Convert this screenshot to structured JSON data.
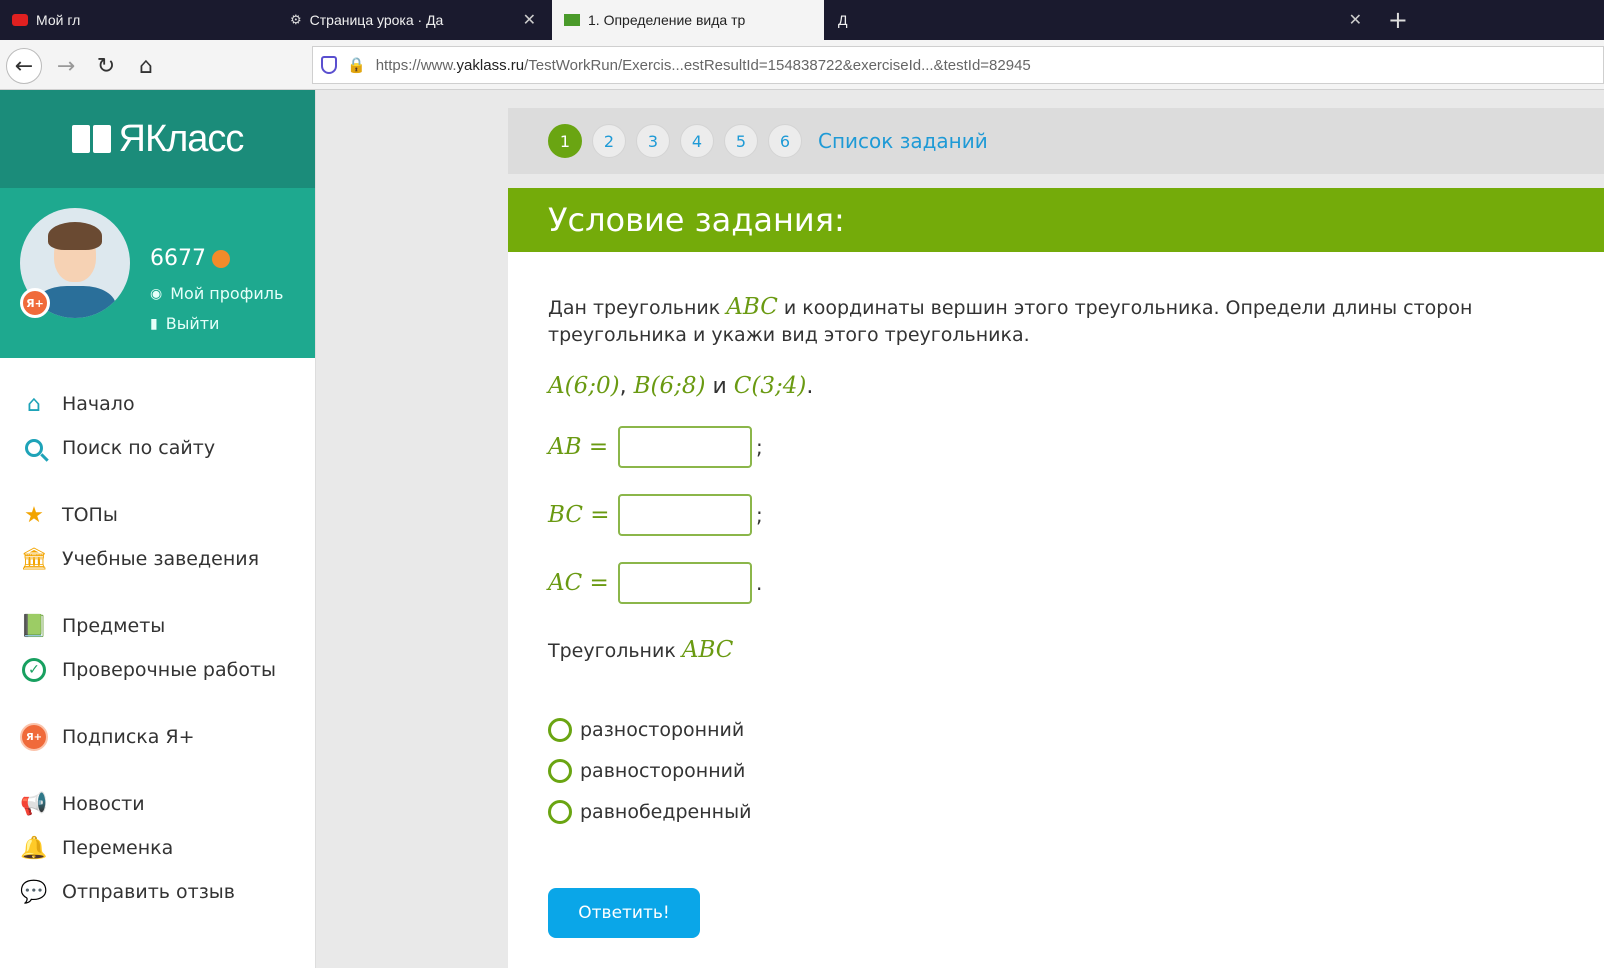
{
  "browser": {
    "tabs": [
      {
        "label": "Мой гл",
        "icon": "youtube-icon"
      },
      {
        "label": "Страница урока · Да",
        "icon": "settings-icon"
      },
      {
        "label": "1. Определение вида тр",
        "icon": "yaklass-favicon-icon"
      },
      {
        "label": "Д",
        "icon": "page-icon"
      }
    ],
    "url_prefix": "https://www.",
    "url_host": "yaklass.ru",
    "url_path": "/TestWorkRun/Exercis...estResultId=154838722&exerciseId...&testId=82945"
  },
  "sidebar": {
    "brand": "ЯКласс",
    "profile": {
      "score": "6677",
      "plus_badge": "Я+",
      "my_profile": "Мой профиль",
      "logout": "Выйти"
    },
    "menu": [
      {
        "label": "Начало",
        "icon": "home-icon"
      },
      {
        "label": "Поиск по сайту",
        "icon": "search-icon"
      },
      {
        "label": "ТОПы",
        "icon": "star-icon"
      },
      {
        "label": "Учебные заведения",
        "icon": "institution-icon"
      },
      {
        "label": "Предметы",
        "icon": "book-icon"
      },
      {
        "label": "Проверочные работы",
        "icon": "check-icon"
      },
      {
        "label": "Подписка Я+",
        "icon": "ya-plus-icon"
      },
      {
        "label": "Новости",
        "icon": "megaphone-icon"
      },
      {
        "label": "Переменка",
        "icon": "bell-icon"
      },
      {
        "label": "Отправить отзыв",
        "icon": "feedback-icon"
      }
    ]
  },
  "pager": {
    "pages": [
      "1",
      "2",
      "3",
      "4",
      "5",
      "6"
    ],
    "current": "1",
    "task_list": "Список заданий"
  },
  "task": {
    "header": "Условие задания:",
    "statement_a": "Дан треугольник ",
    "statement_math": "ABC",
    "statement_b": " и координаты вершин этого треугольника. Определи длины сторон треугольника и укажи вид этого треугольника.",
    "point_a": "A(6;0)",
    "point_b": "B(6;8)",
    "point_c": "C(3;4)",
    "sep1": ", ",
    "and": " и ",
    "end": ".",
    "equations": [
      {
        "label": "AB =",
        "value": "",
        "punct": ";"
      },
      {
        "label": "BC =",
        "value": "",
        "punct": ";"
      },
      {
        "label": "AC =",
        "value": "",
        "punct": "."
      }
    ],
    "triangle_label": "Треугольник ",
    "triangle_math": "ABC",
    "options": [
      "разносторонний",
      "равносторонний",
      "равнобедренный"
    ],
    "submit": "Ответить!"
  }
}
